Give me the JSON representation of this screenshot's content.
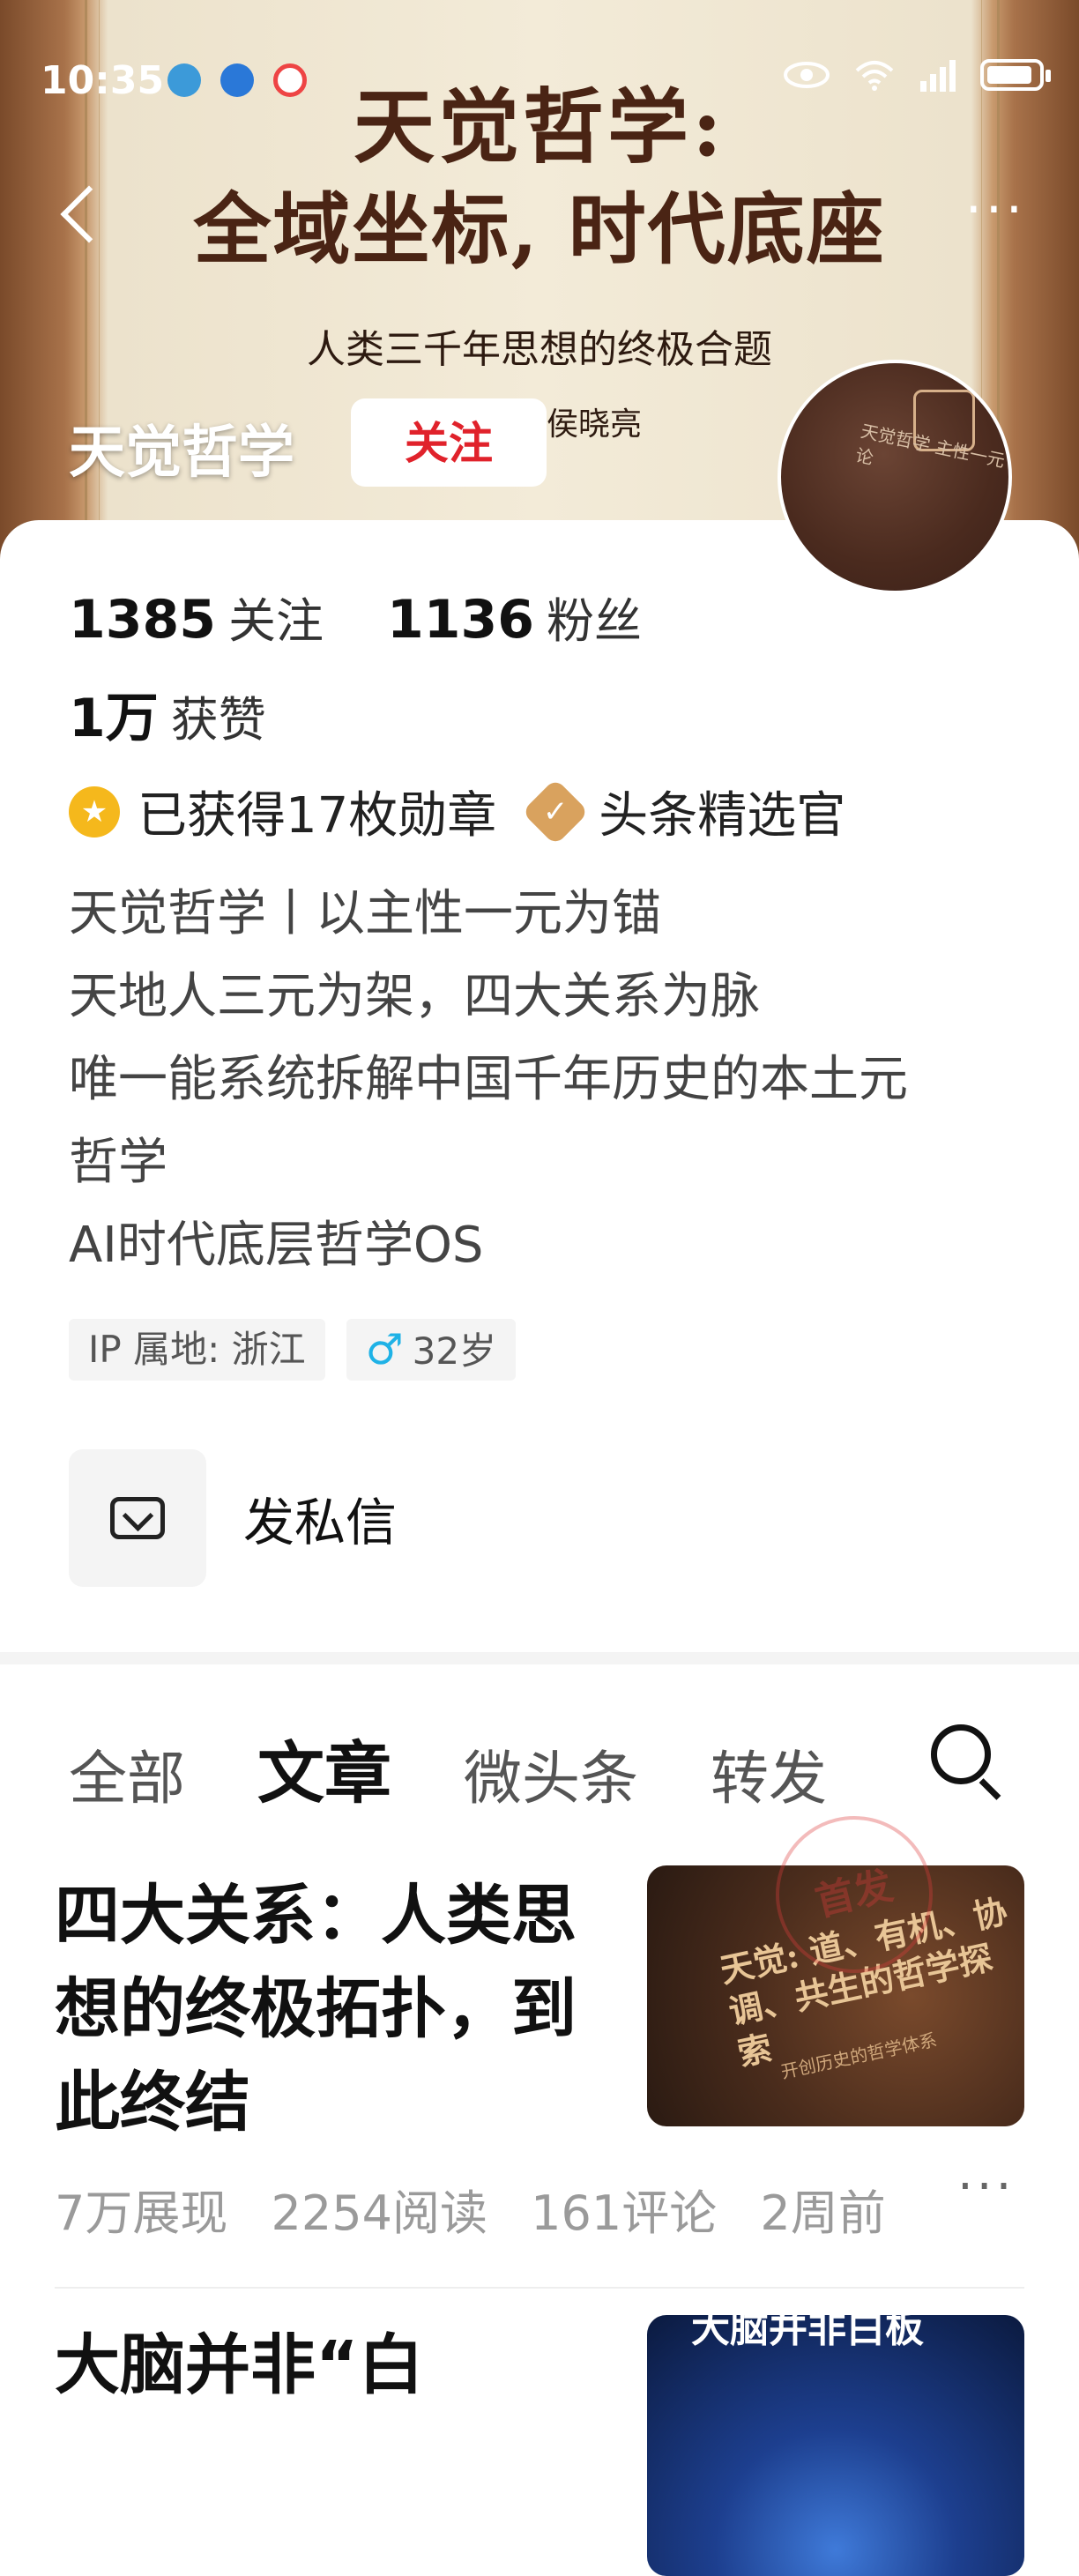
{
  "status_bar": {
    "time": "10:35"
  },
  "cover": {
    "title_line1": "天觉哲学:",
    "title_line2": "全域坐标, 时代底座",
    "subtitle": "人类三千年思想的终极合题",
    "author": "侯晓亮"
  },
  "profile": {
    "name": "天觉哲学",
    "follow_label": "关注",
    "avatar_text": "天觉哲学 主性一元论",
    "following_count": "1385",
    "following_label": "关注",
    "fans_count": "1136",
    "fans_label": "粉丝",
    "likes_count": "1万",
    "likes_label": "获赞",
    "medals_text": "已获得17枚勋章",
    "selector_text": "头条精选官",
    "bio": [
      "天觉哲学丨以主性一元为锚",
      "天地人三元为架，四大关系为脉",
      "唯一能系统拆解中国千年历史的本土元",
      "哲学",
      "AI时代底层哲学OS"
    ],
    "ip_location": "IP 属地: 浙江",
    "age": "32岁",
    "message_label": "发私信"
  },
  "tabs": [
    {
      "label": "全部",
      "active": false
    },
    {
      "label": "文章",
      "active": true
    },
    {
      "label": "微头条",
      "active": false
    },
    {
      "label": "转发",
      "active": false
    }
  ],
  "articles": [
    {
      "title": "四大关系：人类思想的终极拓扑，到此终结",
      "thumb_text": "天觉: 道、有机、协调、共生的哲学探索",
      "thumb_sub": "开创历史的哲学体系",
      "stamp": "首发",
      "impressions": "7万展现",
      "reads": "2254阅读",
      "comments": "161评论",
      "time": "2周前"
    },
    {
      "title": "大脑并非“白",
      "thumb_text": "大脑并非白板"
    }
  ],
  "colors": {
    "follow_red": "#e0222b",
    "medal_gold": "#f5b81c",
    "selector_tan": "#d9a25e"
  }
}
